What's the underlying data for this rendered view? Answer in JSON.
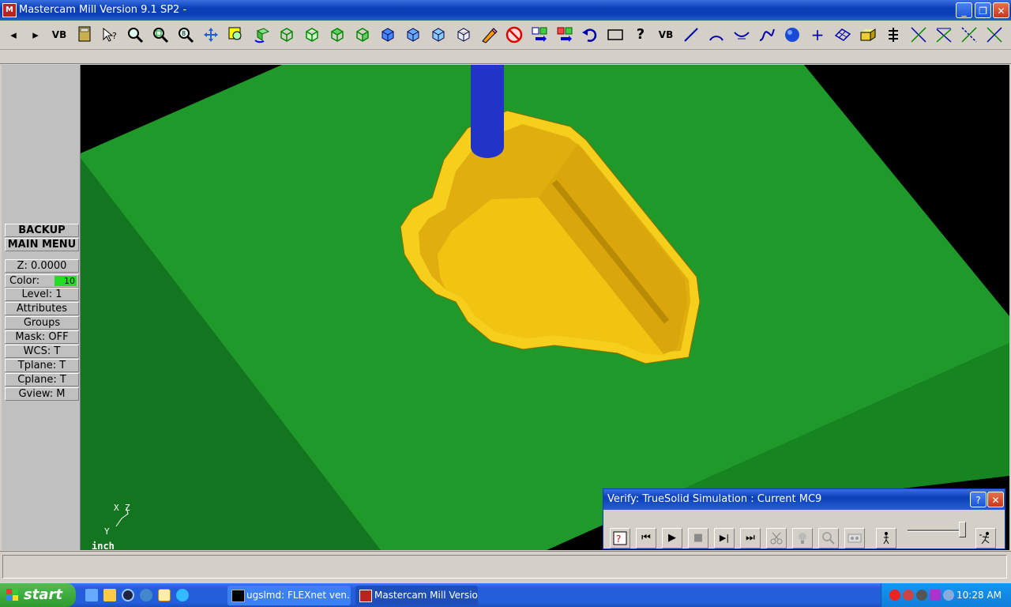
{
  "window": {
    "title": "Mastercam Mill Version 9.1 SP2 -",
    "icon_label": "M",
    "minimize_label": "_",
    "restore_label": "❐",
    "close_label": "✕"
  },
  "toolbar": {
    "items": [
      "back-arrow",
      "forward-arrow",
      "vb-script",
      "calculator",
      "help-query",
      "zoom-in",
      "zoom-window",
      "zoom-out",
      "zoom-target",
      "pan",
      "select-zoom",
      "rotate",
      "cube-iso",
      "cube-front",
      "cube-top",
      "cube-side",
      "cube-shaded",
      "cube-shaded-2",
      "cube-shaded-3",
      "cube-shaded-4",
      "cube-wire",
      "eraser",
      "no-delete",
      "transform-move",
      "transform-copy",
      "undo",
      "rectangle",
      "help",
      "vb",
      "line",
      "arc",
      "fillet",
      "spline",
      "sphere",
      "point",
      "surface",
      "solid",
      "chain-tree",
      "trim",
      "trim-2",
      "trim-3",
      "trim-4"
    ],
    "back_label": "◂",
    "forward_label": "▸",
    "help_label": "?",
    "vb_label": "VB",
    "plus_label": "+"
  },
  "sidebar": {
    "backup": "BACKUP",
    "main_menu": "MAIN MENU",
    "z": "Z:  0.0000",
    "color_label": "Color:",
    "color_value": "10",
    "level": "Level:  1",
    "attributes": "Attributes",
    "groups": "Groups",
    "mask": "Mask:  OFF",
    "wcs": "WCS:   T",
    "tplane": "Tplane:  T",
    "cplane": "Cplane:  T",
    "gview": "Gview:   M"
  },
  "viewport": {
    "axis_x": "X",
    "axis_y": "Y",
    "axis_z": "Z",
    "units": "inch",
    "colors": {
      "stock_top": "#1f9a2a",
      "stock_side_left": "#157a1f",
      "stock_side_right": "#178a22",
      "part": "#f2c412",
      "part_shade": "#c89a08",
      "tool": "#2233c8"
    }
  },
  "verify": {
    "title": "Verify: TrueSolid Simulation : Current MC9",
    "help_label": "?",
    "close_label": "✕",
    "buttons": [
      "help-question",
      "rewind",
      "play",
      "stop",
      "step",
      "fast-forward",
      "cut-scissors",
      "lightbulb",
      "magnifier",
      "cassette",
      "walker",
      "runner"
    ],
    "play_label": "▶",
    "stop_label": "■",
    "rewind_label": "⏮",
    "step_label": "▶|",
    "ff_label": "⏭"
  },
  "taskbar": {
    "start": "start",
    "tasks": [
      {
        "label": "ugslmd:  FLEXnet ven...",
        "icon": "cmd-icon"
      },
      {
        "label": "Mastercam Mill Versio...",
        "icon": "mastercam-icon"
      }
    ],
    "clock": "10:28 AM"
  }
}
